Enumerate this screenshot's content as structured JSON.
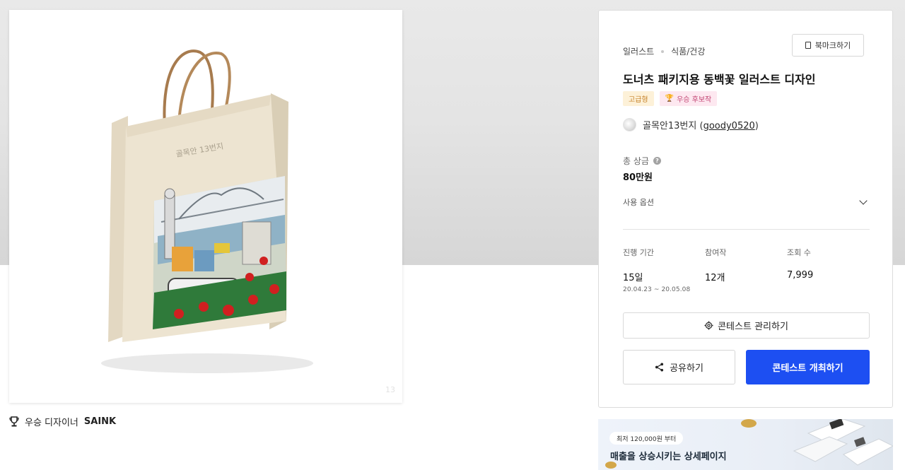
{
  "product": {
    "bag_brand": "골목안 13번지",
    "page_number": "13"
  },
  "winner": {
    "prefix": "우승 디자이너",
    "name": "SAINK"
  },
  "contest": {
    "breadcrumb": [
      "일러스트",
      "식품/건강"
    ],
    "bookmark_label": "북마크하기",
    "title": "도너츠 패키지용 동백꽃 일러스트 디자인",
    "badges": {
      "premium": "고급형",
      "candidate": "우승 후보작"
    },
    "owner": {
      "nickname": "골목안13번지",
      "user_id": "goody0520"
    },
    "prize": {
      "label": "총 상금",
      "value": "80만원"
    },
    "usage_label": "사용 옵션",
    "stats": {
      "period": {
        "label": "진행 기간",
        "value": "15일",
        "range": "20.04.23  ~  20.05.08"
      },
      "participants": {
        "label": "참여작",
        "value": "12개"
      },
      "views": {
        "label": "조회 수",
        "value": "7,999"
      }
    },
    "manage_label": "콘테스트 관리하기",
    "share_label": "공유하기",
    "host_label": "콘테스트 개최하기"
  },
  "ad": {
    "chip": "최저 120,000원 부터",
    "text": "매출을 상승시키는 상세페이지"
  },
  "colors": {
    "primary": "#1d4ff2",
    "premium_bg": "#fdf1d8",
    "candidate_bg": "#fde8f0"
  }
}
